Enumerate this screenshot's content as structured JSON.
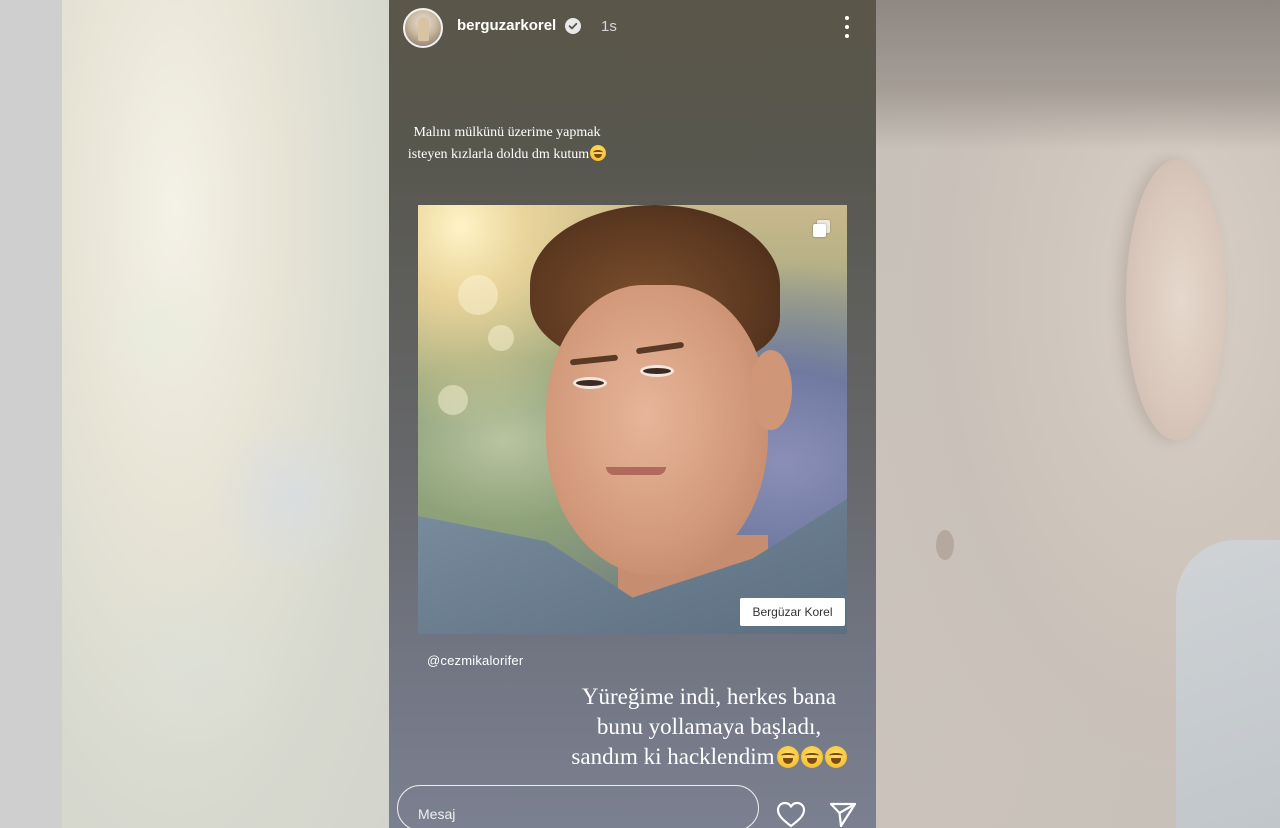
{
  "story": {
    "username": "berguzarkorel",
    "time": "1s",
    "caption_top": "Malını mülkünü üzerime yapmak isteyen kızlarla doldu dm kutum",
    "post_watermark": "Bergüzar Korel",
    "mention": "@cezmikalorifer",
    "caption_bottom": "Yüreğime indi, herkes bana bunu yollamaya başladı, sandım ki hacklendim",
    "message_placeholder": "Mesaj"
  },
  "icons": [
    "verified-icon",
    "more-icon",
    "carousel-icon",
    "emoji-icon",
    "heart-icon",
    "send-icon"
  ],
  "colors": {
    "text": "#ffffff",
    "story_bg_top": "#5a5649",
    "story_bg_bottom": "#7b8090"
  }
}
